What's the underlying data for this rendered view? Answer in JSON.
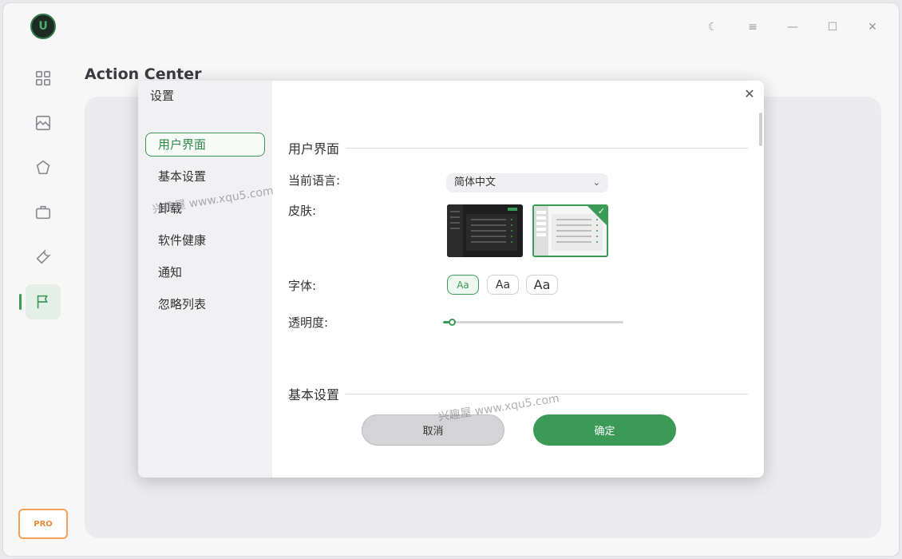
{
  "background": {
    "title": "Action Center",
    "pro_label": "PRO"
  },
  "nav": {
    "items": [
      {
        "icon": "dashboard-icon"
      },
      {
        "icon": "image-icon"
      },
      {
        "icon": "cleanup-icon"
      },
      {
        "icon": "toolbox-icon"
      },
      {
        "icon": "tools-icon"
      },
      {
        "icon": "flag-icon",
        "active": true
      }
    ]
  },
  "window_controls": [
    "theme-toggle-icon",
    "menu-icon",
    "minimize-icon",
    "maximize-icon",
    "close-icon"
  ],
  "modal": {
    "title": "设置",
    "menu": [
      {
        "label": "用户界面",
        "active": true
      },
      {
        "label": "基本设置"
      },
      {
        "label": "卸载"
      },
      {
        "label": "软件健康"
      },
      {
        "label": "通知"
      },
      {
        "label": "忽略列表"
      }
    ],
    "section_ui": "用户界面",
    "language_label": "当前语言:",
    "language_value": "简体中文",
    "skin_label": "皮肤:",
    "font_label": "字体:",
    "font_options": [
      "Aa",
      "Aa",
      "Aa"
    ],
    "font_selected_index": 0,
    "opacity_label": "透明度:",
    "opacity_value": 0.05,
    "section_basic": "基本设置",
    "cancel_label": "取消",
    "ok_label": "确定"
  },
  "watermark": "兴趣屋 www.xqu5.com",
  "colors": {
    "accent": "#3a9a56",
    "pro": "#ec8a3a"
  }
}
